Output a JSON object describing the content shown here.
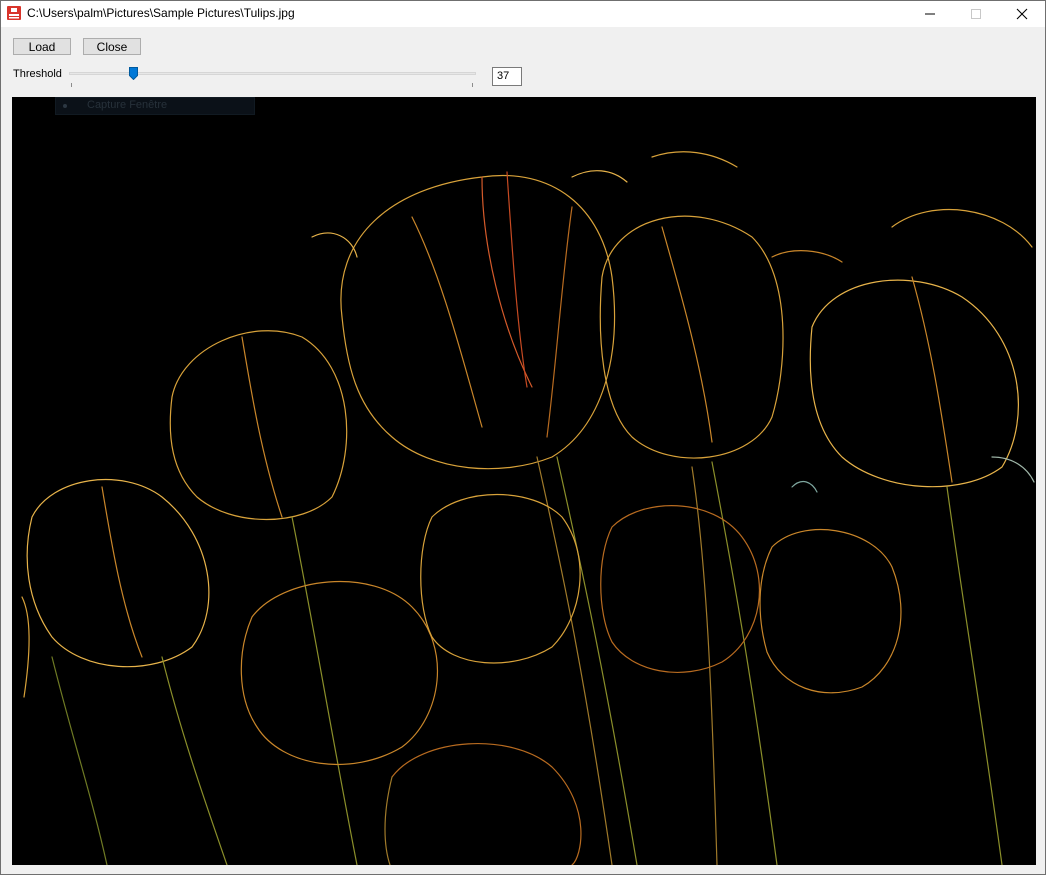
{
  "window": {
    "title": "C:\\Users\\palm\\Pictures\\Sample Pictures\\Tulips.jpg",
    "icon": "app-icon",
    "controls": {
      "minimize": "minimize-icon",
      "maximize": "maximize-icon",
      "close": "close-icon"
    }
  },
  "toolbar": {
    "load_label": "Load",
    "close_label": "Close"
  },
  "threshold": {
    "label": "Threshold",
    "value": "37",
    "slider_fraction": 0.15
  },
  "canvas": {
    "ghost_tooltip": "Capture Fenêtre",
    "background": "#000000",
    "edge_colors": [
      "#d8a23a",
      "#c9862a",
      "#b86b20",
      "#e7b34a",
      "#d45a2a",
      "#8b8f2a"
    ]
  },
  "colors": {
    "accent": "#0078d7",
    "button_face": "#e1e1e1",
    "window_face": "#f0f0f0"
  }
}
